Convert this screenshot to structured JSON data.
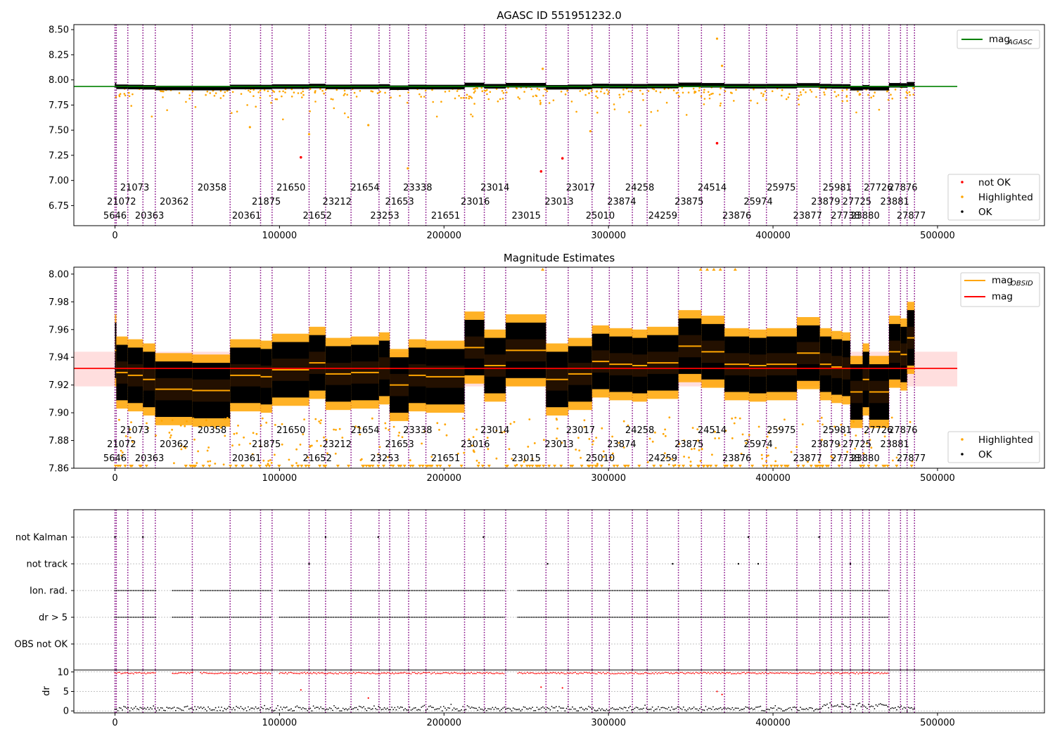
{
  "chart_data": [
    {
      "type": "scatter",
      "title": "AGASC ID 551951232.0",
      "xlim": [
        -25000,
        565000
      ],
      "ylim": [
        6.55,
        8.55
      ],
      "xticks": [
        0,
        100000,
        200000,
        300000,
        400000,
        500000
      ],
      "yticks": [
        "6.75",
        "7.00",
        "7.25",
        "7.50",
        "7.75",
        "8.00",
        "8.25",
        "8.50"
      ],
      "reference_line": {
        "name": "mag_AGASC",
        "y": 7.935,
        "x_range": [
          -25000,
          512000
        ],
        "color": "#008000"
      },
      "series": [
        {
          "name": "not OK",
          "color": "#ff0000",
          "points": [
            [
              113000,
              7.23
            ],
            [
              259000,
              7.09
            ],
            [
              272000,
              7.22
            ],
            [
              366000,
              7.37
            ]
          ]
        },
        {
          "name": "Highlighted",
          "color": "#ffa500",
          "band": {
            "x0": 0,
            "x1": 486000,
            "low": 7.45,
            "high": 7.93
          },
          "outliers": [
            [
              366000,
              8.41
            ],
            [
              369000,
              8.14
            ],
            [
              260000,
              8.11
            ],
            [
              178000,
              7.12
            ],
            [
              82000,
              7.53
            ],
            [
              154000,
              7.55
            ],
            [
              118000,
              7.46
            ],
            [
              289000,
              7.49
            ]
          ]
        },
        {
          "name": "OK",
          "color": "#000000",
          "segments_ref": "segments"
        }
      ],
      "legend": {
        "position": "lower-right",
        "entries": [
          "not OK",
          "Highlighted",
          "OK"
        ]
      },
      "legend_top": {
        "position": "upper-right",
        "entries": [
          "mag_AGASC"
        ]
      }
    },
    {
      "type": "scatter",
      "title": "Magnitude Estimates",
      "xlim": [
        -25000,
        565000
      ],
      "ylim": [
        7.86,
        8.005
      ],
      "xticks": [
        0,
        100000,
        200000,
        300000,
        400000,
        500000
      ],
      "yticks": [
        "7.86",
        "7.88",
        "7.90",
        "7.92",
        "7.94",
        "7.96",
        "7.98",
        "8.00"
      ],
      "mag_line": {
        "name": "mag",
        "y": 7.932,
        "x_range": [
          -25000,
          512000
        ],
        "color": "#ff0000"
      },
      "mag_band": {
        "low": 7.919,
        "high": 7.944
      },
      "series": [
        {
          "name": "mag_OBSID",
          "color": "#ffa500",
          "values_ref": "segments"
        },
        {
          "name": "Highlighted",
          "color": "#ffa500"
        },
        {
          "name": "OK",
          "color": "#000000"
        }
      ],
      "legend_top": {
        "position": "upper-right",
        "entries": [
          "mag_OBSID",
          "mag"
        ]
      },
      "legend": {
        "position": "lower-right",
        "entries": [
          "Highlighted",
          "OK"
        ]
      }
    },
    {
      "type": "scatter",
      "title": "",
      "xlim": [
        -25000,
        565000
      ],
      "categories": [
        "not Kalman",
        "not track",
        "Ion. rad.",
        "dr > 5",
        "OBS not OK"
      ],
      "flag_ranges": {
        "Ion. rad.": [
          [
            0,
            25000
          ],
          [
            35000,
            48000
          ],
          [
            52000,
            70000
          ],
          [
            71000,
            95000
          ],
          [
            100000,
            237000
          ],
          [
            245000,
            470000
          ]
        ],
        "dr > 5": [
          [
            0,
            25000
          ],
          [
            35000,
            48000
          ],
          [
            52000,
            70000
          ],
          [
            71000,
            95000
          ],
          [
            100000,
            237000
          ],
          [
            245000,
            470000
          ]
        ]
      },
      "flag_points": {
        "not Kalman": [
          0,
          17000,
          128000,
          160000,
          224000,
          385000,
          428000
        ],
        "not track": [
          118000,
          263000,
          339000,
          379000,
          391000,
          447000
        ]
      }
    },
    {
      "type": "scatter",
      "ylabel": "dr",
      "xlim": [
        -25000,
        565000
      ],
      "ylim": [
        -0.5,
        10.5
      ],
      "yticks": [
        "0",
        "5",
        "10"
      ],
      "xticks": [
        0,
        100000,
        200000,
        300000,
        400000,
        500000
      ],
      "series": [
        {
          "name": "dr",
          "color": "#000000",
          "typical": 0.6
        },
        {
          "name": "dr > 5",
          "color": "#ff0000",
          "value": 9.7,
          "outliers": [
            [
              113000,
              5.4
            ],
            [
              154000,
              3.3
            ],
            [
              259000,
              6.1
            ],
            [
              272000,
              5.9
            ],
            [
              366000,
              5.0
            ],
            [
              369000,
              4.2
            ]
          ]
        }
      ]
    }
  ],
  "segments": [
    {
      "obsid": "5646",
      "x0": 0,
      "x1": 800,
      "mag": 7.945
    },
    {
      "obsid": "21072",
      "x0": 800,
      "x1": 7800,
      "mag": 7.929
    },
    {
      "obsid": "21073",
      "x0": 7800,
      "x1": 17000,
      "mag": 7.927
    },
    {
      "obsid": "20363",
      "x0": 17000,
      "x1": 24500,
      "mag": 7.924
    },
    {
      "obsid": "20362",
      "x0": 24500,
      "x1": 47000,
      "mag": 7.917
    },
    {
      "obsid": "20358",
      "x0": 47000,
      "x1": 70000,
      "mag": 7.916
    },
    {
      "obsid": "20361",
      "x0": 70000,
      "x1": 88500,
      "mag": 7.927
    },
    {
      "obsid": "21875",
      "x0": 88500,
      "x1": 95500,
      "mag": 7.926
    },
    {
      "obsid": "21650",
      "x0": 95500,
      "x1": 118000,
      "mag": 7.931
    },
    {
      "obsid": "21652",
      "x0": 118000,
      "x1": 128000,
      "mag": 7.936
    },
    {
      "obsid": "23212",
      "x0": 128000,
      "x1": 143500,
      "mag": 7.928
    },
    {
      "obsid": "21654",
      "x0": 143500,
      "x1": 160500,
      "mag": 7.929
    },
    {
      "obsid": "23253",
      "x0": 160500,
      "x1": 167000,
      "mag": 7.932
    },
    {
      "obsid": "21653",
      "x0": 167000,
      "x1": 178500,
      "mag": 7.92
    },
    {
      "obsid": "23338",
      "x0": 178500,
      "x1": 189000,
      "mag": 7.927
    },
    {
      "obsid": "21651",
      "x0": 189000,
      "x1": 212500,
      "mag": 7.926
    },
    {
      "obsid": "23016",
      "x0": 212500,
      "x1": 224500,
      "mag": 7.947
    },
    {
      "obsid": "23014",
      "x0": 224500,
      "x1": 237500,
      "mag": 7.934
    },
    {
      "obsid": "23015",
      "x0": 237500,
      "x1": 262000,
      "mag": 7.945
    },
    {
      "obsid": "23013",
      "x0": 262000,
      "x1": 275500,
      "mag": 7.924
    },
    {
      "obsid": "23017",
      "x0": 275500,
      "x1": 290000,
      "mag": 7.928
    },
    {
      "obsid": "25010",
      "x0": 290000,
      "x1": 300500,
      "mag": 7.937
    },
    {
      "obsid": "23874",
      "x0": 300500,
      "x1": 314500,
      "mag": 7.935
    },
    {
      "obsid": "24258",
      "x0": 314500,
      "x1": 323500,
      "mag": 7.934
    },
    {
      "obsid": "24259",
      "x0": 323500,
      "x1": 342500,
      "mag": 7.936
    },
    {
      "obsid": "23875",
      "x0": 342500,
      "x1": 356500,
      "mag": 7.948
    },
    {
      "obsid": "24514",
      "x0": 356500,
      "x1": 370500,
      "mag": 7.944
    },
    {
      "obsid": "23876",
      "x0": 370500,
      "x1": 385500,
      "mag": 7.935
    },
    {
      "obsid": "25974",
      "x0": 385500,
      "x1": 396000,
      "mag": 7.934
    },
    {
      "obsid": "25975",
      "x0": 396000,
      "x1": 414500,
      "mag": 7.935
    },
    {
      "obsid": "23877",
      "x0": 414500,
      "x1": 428500,
      "mag": 7.943
    },
    {
      "obsid": "23879",
      "x0": 428500,
      "x1": 435500,
      "mag": 7.935
    },
    {
      "obsid": "25981",
      "x0": 435500,
      "x1": 442000,
      "mag": 7.933
    },
    {
      "obsid": "27738",
      "x0": 442000,
      "x1": 447000,
      "mag": 7.932
    },
    {
      "obsid": "27725",
      "x0": 447000,
      "x1": 454500,
      "mag": 7.915
    },
    {
      "obsid": "23880",
      "x0": 454500,
      "x1": 458500,
      "mag": 7.924
    },
    {
      "obsid": "27726",
      "x0": 458500,
      "x1": 470500,
      "mag": 7.915
    },
    {
      "obsid": "23881",
      "x0": 470500,
      "x1": 477500,
      "mag": 7.944
    },
    {
      "obsid": "27876",
      "x0": 477500,
      "x1": 481500,
      "mag": 7.942
    },
    {
      "obsid": "27877",
      "x0": 481500,
      "x1": 486000,
      "mag": 7.954
    }
  ],
  "obs_labels": [
    {
      "text": "5646",
      "x": 0,
      "row": 2
    },
    {
      "text": "21072",
      "x": 4000,
      "row": 1
    },
    {
      "text": "21073",
      "x": 12000,
      "row": 0
    },
    {
      "text": "20363",
      "x": 21000,
      "row": 2
    },
    {
      "text": "20362",
      "x": 36000,
      "row": 1
    },
    {
      "text": "20358",
      "x": 59000,
      "row": 0
    },
    {
      "text": "20361",
      "x": 80000,
      "row": 2
    },
    {
      "text": "21875",
      "x": 92000,
      "row": 1
    },
    {
      "text": "21650",
      "x": 107000,
      "row": 0
    },
    {
      "text": "21652",
      "x": 123000,
      "row": 2
    },
    {
      "text": "23212",
      "x": 135000,
      "row": 1
    },
    {
      "text": "21654",
      "x": 152000,
      "row": 0
    },
    {
      "text": "23253",
      "x": 164000,
      "row": 2
    },
    {
      "text": "21653",
      "x": 173000,
      "row": 1
    },
    {
      "text": "23338",
      "x": 184000,
      "row": 0
    },
    {
      "text": "21651",
      "x": 201000,
      "row": 2
    },
    {
      "text": "23016",
      "x": 219000,
      "row": 1
    },
    {
      "text": "23014",
      "x": 231000,
      "row": 0
    },
    {
      "text": "23015",
      "x": 250000,
      "row": 2
    },
    {
      "text": "23013",
      "x": 270000,
      "row": 1
    },
    {
      "text": "23017",
      "x": 283000,
      "row": 0
    },
    {
      "text": "25010",
      "x": 295000,
      "row": 2
    },
    {
      "text": "23874",
      "x": 308000,
      "row": 1
    },
    {
      "text": "24258",
      "x": 319000,
      "row": 0
    },
    {
      "text": "24259",
      "x": 333000,
      "row": 2
    },
    {
      "text": "23875",
      "x": 349000,
      "row": 1
    },
    {
      "text": "24514",
      "x": 363000,
      "row": 0
    },
    {
      "text": "23876",
      "x": 378000,
      "row": 2
    },
    {
      "text": "25974",
      "x": 391000,
      "row": 1
    },
    {
      "text": "25975",
      "x": 405000,
      "row": 0
    },
    {
      "text": "23877",
      "x": 421000,
      "row": 2
    },
    {
      "text": "23879",
      "x": 432000,
      "row": 1
    },
    {
      "text": "25981",
      "x": 439000,
      "row": 0
    },
    {
      "text": "27738",
      "x": 444000,
      "row": 2
    },
    {
      "text": "27725",
      "x": 451000,
      "row": 1
    },
    {
      "text": "23880",
      "x": 456000,
      "row": 2
    },
    {
      "text": "27726",
      "x": 464000,
      "row": 0
    },
    {
      "text": "23881",
      "x": 474000,
      "row": 1
    },
    {
      "text": "27876",
      "x": 479000,
      "row": 0
    },
    {
      "text": "27877",
      "x": 484000,
      "row": 2
    }
  ],
  "vlines": [
    0,
    800,
    7800,
    17000,
    24500,
    47000,
    70000,
    88500,
    95500,
    118000,
    128000,
    143500,
    160500,
    167000,
    178500,
    189000,
    212500,
    224500,
    237500,
    262000,
    275500,
    290000,
    300500,
    314500,
    323500,
    342500,
    356500,
    370500,
    385500,
    396000,
    414500,
    428500,
    435500,
    442000,
    447000,
    454500,
    458500,
    470500,
    477500,
    481500,
    486000
  ],
  "legends": {
    "mag_agasc": "mag",
    "mag_agasc_sub": "AGASC",
    "not_ok": "not OK",
    "highlighted": "Highlighted",
    "ok": "OK",
    "mag_obsid": "mag",
    "mag_obsid_sub": "OBSID",
    "mag": "mag",
    "highlighted2": "Highlighted",
    "ok2": "OK"
  },
  "colors": {
    "black": "#000000",
    "orange": "#ffa500",
    "red": "#ff0000",
    "green": "#008000",
    "purple": "#800080",
    "band": "#ffdede",
    "grid": "#b0b0b0"
  }
}
